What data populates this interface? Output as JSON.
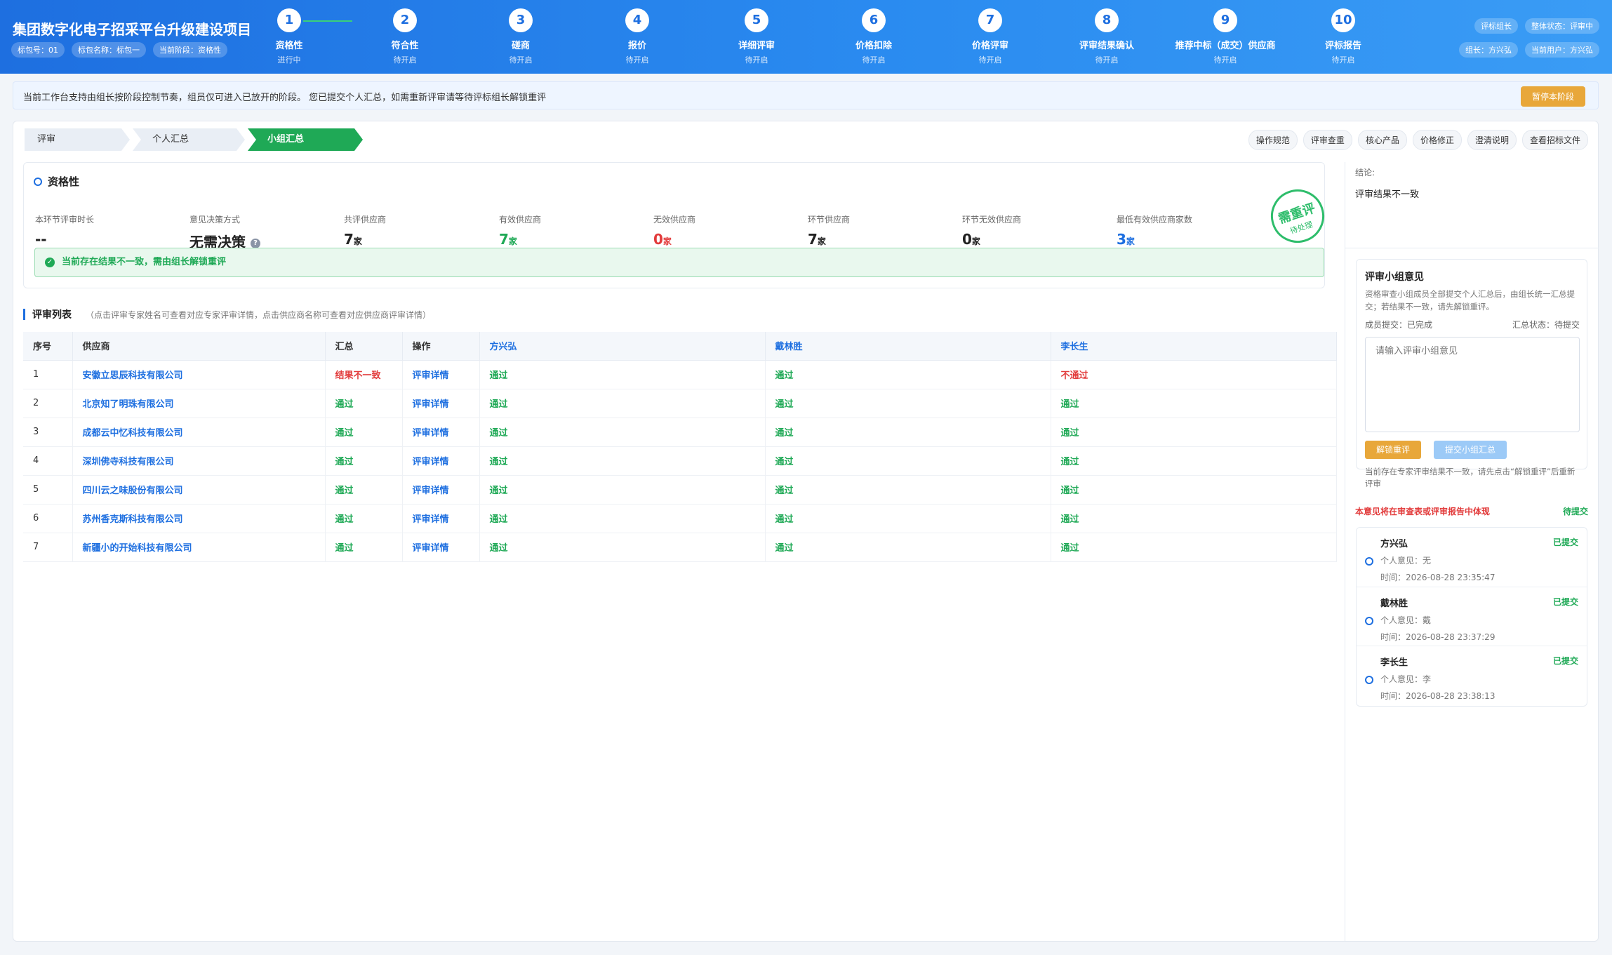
{
  "header": {
    "title": "集团数字化电子招采平台升级建设项目",
    "tags": [
      "标包号：01",
      "标包名称：标包一",
      "当前阶段：资格性"
    ],
    "right_top": [
      "评标组长",
      "整体状态：评审中"
    ],
    "right_bottom": [
      "组长：方兴弘",
      "当前用户：方兴弘"
    ]
  },
  "steps": [
    {
      "num": "1",
      "label": "资格性",
      "status": "进行中"
    },
    {
      "num": "2",
      "label": "符合性",
      "status": "待开启"
    },
    {
      "num": "3",
      "label": "磋商",
      "status": "待开启"
    },
    {
      "num": "4",
      "label": "报价",
      "status": "待开启"
    },
    {
      "num": "5",
      "label": "详细评审",
      "status": "待开启"
    },
    {
      "num": "6",
      "label": "价格扣除",
      "status": "待开启"
    },
    {
      "num": "7",
      "label": "价格评审",
      "status": "待开启"
    },
    {
      "num": "8",
      "label": "评审结果确认",
      "status": "待开启"
    },
    {
      "num": "9",
      "label": "推荐中标（成交）供应商",
      "status": "待开启"
    },
    {
      "num": "10",
      "label": "评标报告",
      "status": "待开启"
    }
  ],
  "notice": {
    "text": "当前工作台支持由组长按阶段控制节奏，组员仅可进入已放开的阶段。 您已提交个人汇总，如需重新评审请等待评标组长解锁重评",
    "pause_button": "暂停本阶段"
  },
  "tabs": {
    "review": "评审",
    "personal": "个人汇总",
    "group": "小组汇总"
  },
  "toolbar": [
    "操作规范",
    "评审查重",
    "核心产品",
    "价格修正",
    "澄清说明",
    "查看招标文件"
  ],
  "summary": {
    "title": "资格性",
    "stats": [
      {
        "label": "本环节评审时长",
        "value": "--",
        "unit": "",
        "color": "#222222"
      },
      {
        "label": "意见决策方式",
        "value": "无需决策",
        "unit": "",
        "color": "#222222",
        "help": "?"
      },
      {
        "label": "共评供应商",
        "value": "7",
        "unit": "家",
        "color": "#222222"
      },
      {
        "label": "有效供应商",
        "value": "7",
        "unit": "家",
        "color": "#1fa956"
      },
      {
        "label": "无效供应商",
        "value": "0",
        "unit": "家",
        "color": "#e23b3b"
      },
      {
        "label": "环节供应商",
        "value": "7",
        "unit": "家",
        "color": "#222222"
      },
      {
        "label": "环节无效供应商",
        "value": "0",
        "unit": "家",
        "color": "#222222"
      },
      {
        "label": "最低有效供应商家数",
        "value": "3",
        "unit": "家",
        "color": "#1e6fe0"
      }
    ],
    "stamp_main": "需重评",
    "stamp_sub": "待处理",
    "alert": "当前存在结果不一致，需由组长解锁重评"
  },
  "list": {
    "title": "评审列表",
    "hint": "（点击评审专家姓名可查看对应专家评审详情，点击供应商名称可查看对应供应商评审详情）",
    "headers": [
      "序号",
      "供应商",
      "汇总",
      "操作",
      "方兴弘",
      "戴林胜",
      "李长生"
    ],
    "rows": [
      {
        "idx": "1",
        "supplier": "安徽立思辰科技有限公司",
        "summary": "结果不一致",
        "action": "评审详情",
        "e1": "通过",
        "e2": "通过",
        "e3": "不通过"
      },
      {
        "idx": "2",
        "supplier": "北京知了明珠有限公司",
        "summary": "通过",
        "action": "评审详情",
        "e1": "通过",
        "e2": "通过",
        "e3": "通过"
      },
      {
        "idx": "3",
        "supplier": "成都云中忆科技有限公司",
        "summary": "通过",
        "action": "评审详情",
        "e1": "通过",
        "e2": "通过",
        "e3": "通过"
      },
      {
        "idx": "4",
        "supplier": "深圳佛寺科技有限公司",
        "summary": "通过",
        "action": "评审详情",
        "e1": "通过",
        "e2": "通过",
        "e3": "通过"
      },
      {
        "idx": "5",
        "supplier": "四川云之味股份有限公司",
        "summary": "通过",
        "action": "评审详情",
        "e1": "通过",
        "e2": "通过",
        "e3": "通过"
      },
      {
        "idx": "6",
        "supplier": "苏州香克斯科技有限公司",
        "summary": "通过",
        "action": "评审详情",
        "e1": "通过",
        "e2": "通过",
        "e3": "通过"
      },
      {
        "idx": "7",
        "supplier": "新疆小的开始科技有限公司",
        "summary": "通过",
        "action": "评审详情",
        "e1": "通过",
        "e2": "通过",
        "e3": "通过"
      }
    ]
  },
  "side": {
    "conclusion_label": "结论:",
    "conclusion_value": "评审结果不一致",
    "opinion_title": "评审小组意见",
    "opinion_desc": "资格审查小组成员全部提交个人汇总后，由组长统一汇总提交；若结果不一致，请先解锁重评。",
    "member_submit": "成员提交：已完成",
    "summary_status": "汇总状态：待提交",
    "placeholder": "请输入评审小组意见",
    "unlock_button": "解锁重评",
    "submit_button": "提交小组汇总",
    "warn": "当前存在专家评审结果不一致，请先点击“解锁重评”后重新评审",
    "remark": "本意见将在审查表或评审报告中体现",
    "remark_status": "待提交",
    "members": [
      {
        "name": "方兴弘",
        "state": "已提交",
        "opinion": "个人意见：无",
        "time": "时间：2026-08-28 23:35:47"
      },
      {
        "name": "戴林胜",
        "state": "已提交",
        "opinion": "个人意见：戴",
        "time": "时间：2026-08-28 23:37:29"
      },
      {
        "name": "李长生",
        "state": "已提交",
        "opinion": "个人意见：李",
        "time": "时间：2026-08-28 23:38:13"
      }
    ]
  }
}
